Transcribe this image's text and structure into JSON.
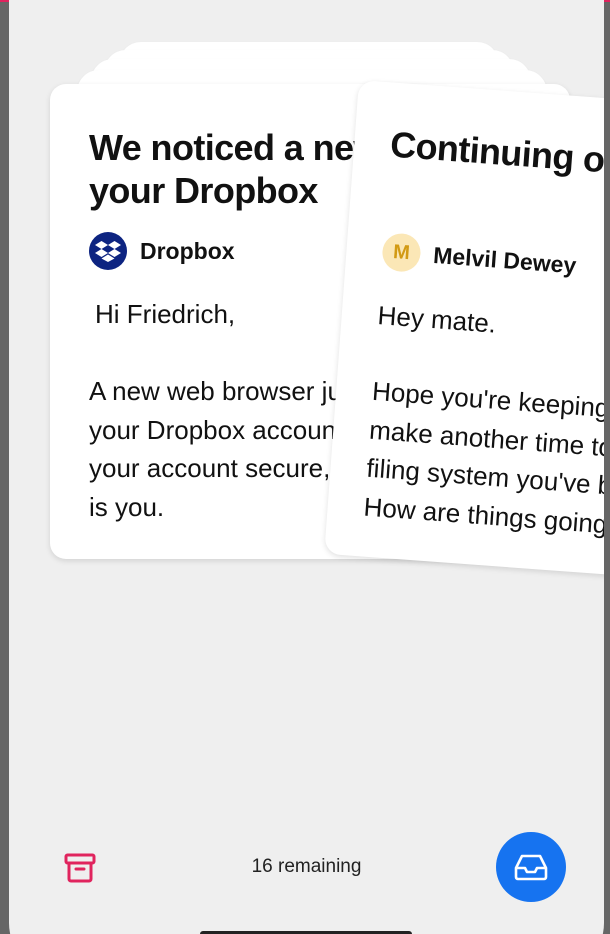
{
  "colors": {
    "accent_top": "#e0245e",
    "archive_icon": "#e0245e",
    "fab_bg": "#1673f0",
    "dropbox_avatar_bg": "#0d2481",
    "melvil_avatar_bg": "#fbe7b6",
    "melvil_avatar_fg": "#d29a14"
  },
  "cards": {
    "front": {
      "title": "We noticed a new sign-in to your Dropbox",
      "sender": "Dropbox",
      "sender_icon": "dropbox-logo-icon",
      "greeting": "Hi Friedrich,",
      "body": "A new web browser just signed in to your Dropbox account. To help keep your account secure, let us know if this is you."
    },
    "swiping": {
      "title": "Continuing our discussions",
      "sender": "Melvil Dewey",
      "avatar_letter": "M",
      "greeting": "Hey mate.",
      "body": "Hope you're keeping well. Would love to make another time to discuss the new filing system you've been developing. How are things going?"
    }
  },
  "bottom_bar": {
    "archive_icon": "archive-icon",
    "remaining_text": "16 remaining",
    "inbox_icon": "inbox-icon"
  }
}
